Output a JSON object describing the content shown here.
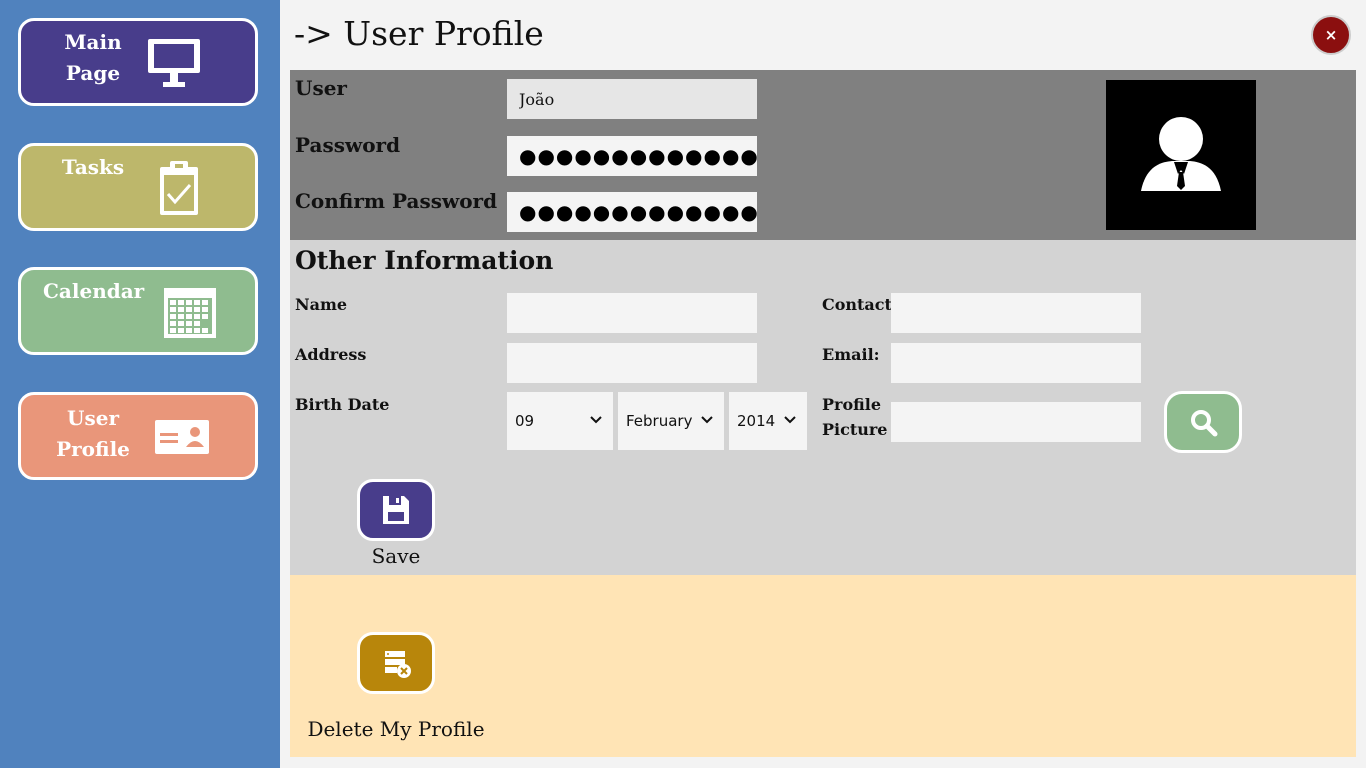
{
  "sidebar": {
    "items": [
      {
        "label_line1": "Main",
        "label_line2": "Page",
        "icon": "monitor-icon",
        "color": "#483d8b"
      },
      {
        "label_line1": "Tasks",
        "label_line2": "",
        "icon": "clipboard-check-icon",
        "color": "#bdb76b"
      },
      {
        "label_line1": "Calendar",
        "label_line2": "",
        "icon": "calendar-icon",
        "color": "#8fbc8f"
      },
      {
        "label_line1": "User",
        "label_line2": "Profile",
        "icon": "id-card-icon",
        "color": "#e9967a"
      }
    ]
  },
  "header": {
    "title": "-> User Profile",
    "close_icon": "×"
  },
  "account": {
    "user_label": "User",
    "user_value": "João",
    "password_label": "Password",
    "password_value": "●●●●●●●●●●●●●●●●●●●",
    "confirm_label": "Confirm Password",
    "confirm_value": "●●●●●●●●●●●●●●●●●●●",
    "avatar_icon": "user-avatar-icon"
  },
  "other_info": {
    "title": "Other Information",
    "name_label": "Name",
    "name_value": "",
    "address_label": "Address",
    "address_value": "",
    "birth_label": "Birth Date",
    "day": "09",
    "month": "February",
    "year": "2014",
    "contact_label": "Contact",
    "contact_value": "",
    "email_label": "Email:",
    "email_value": "",
    "picture_label_line1": "Profile",
    "picture_label_line2": "Picture",
    "picture_value": "",
    "search_icon": "search-icon",
    "save_label": "Save",
    "save_icon": "floppy-disk-icon"
  },
  "danger_zone": {
    "delete_label": "Delete My Profile",
    "delete_icon": "delete-database-icon"
  },
  "colors": {
    "sidebar_bg": "#5082be",
    "account_bg": "#808080",
    "info_bg": "#d3d3d3",
    "danger_bg": "#ffe4b5",
    "close_bg": "#8b0f0f",
    "save_bg": "#483d8b",
    "delete_bg": "#b8860b",
    "search_bg": "#8fbc8f"
  }
}
